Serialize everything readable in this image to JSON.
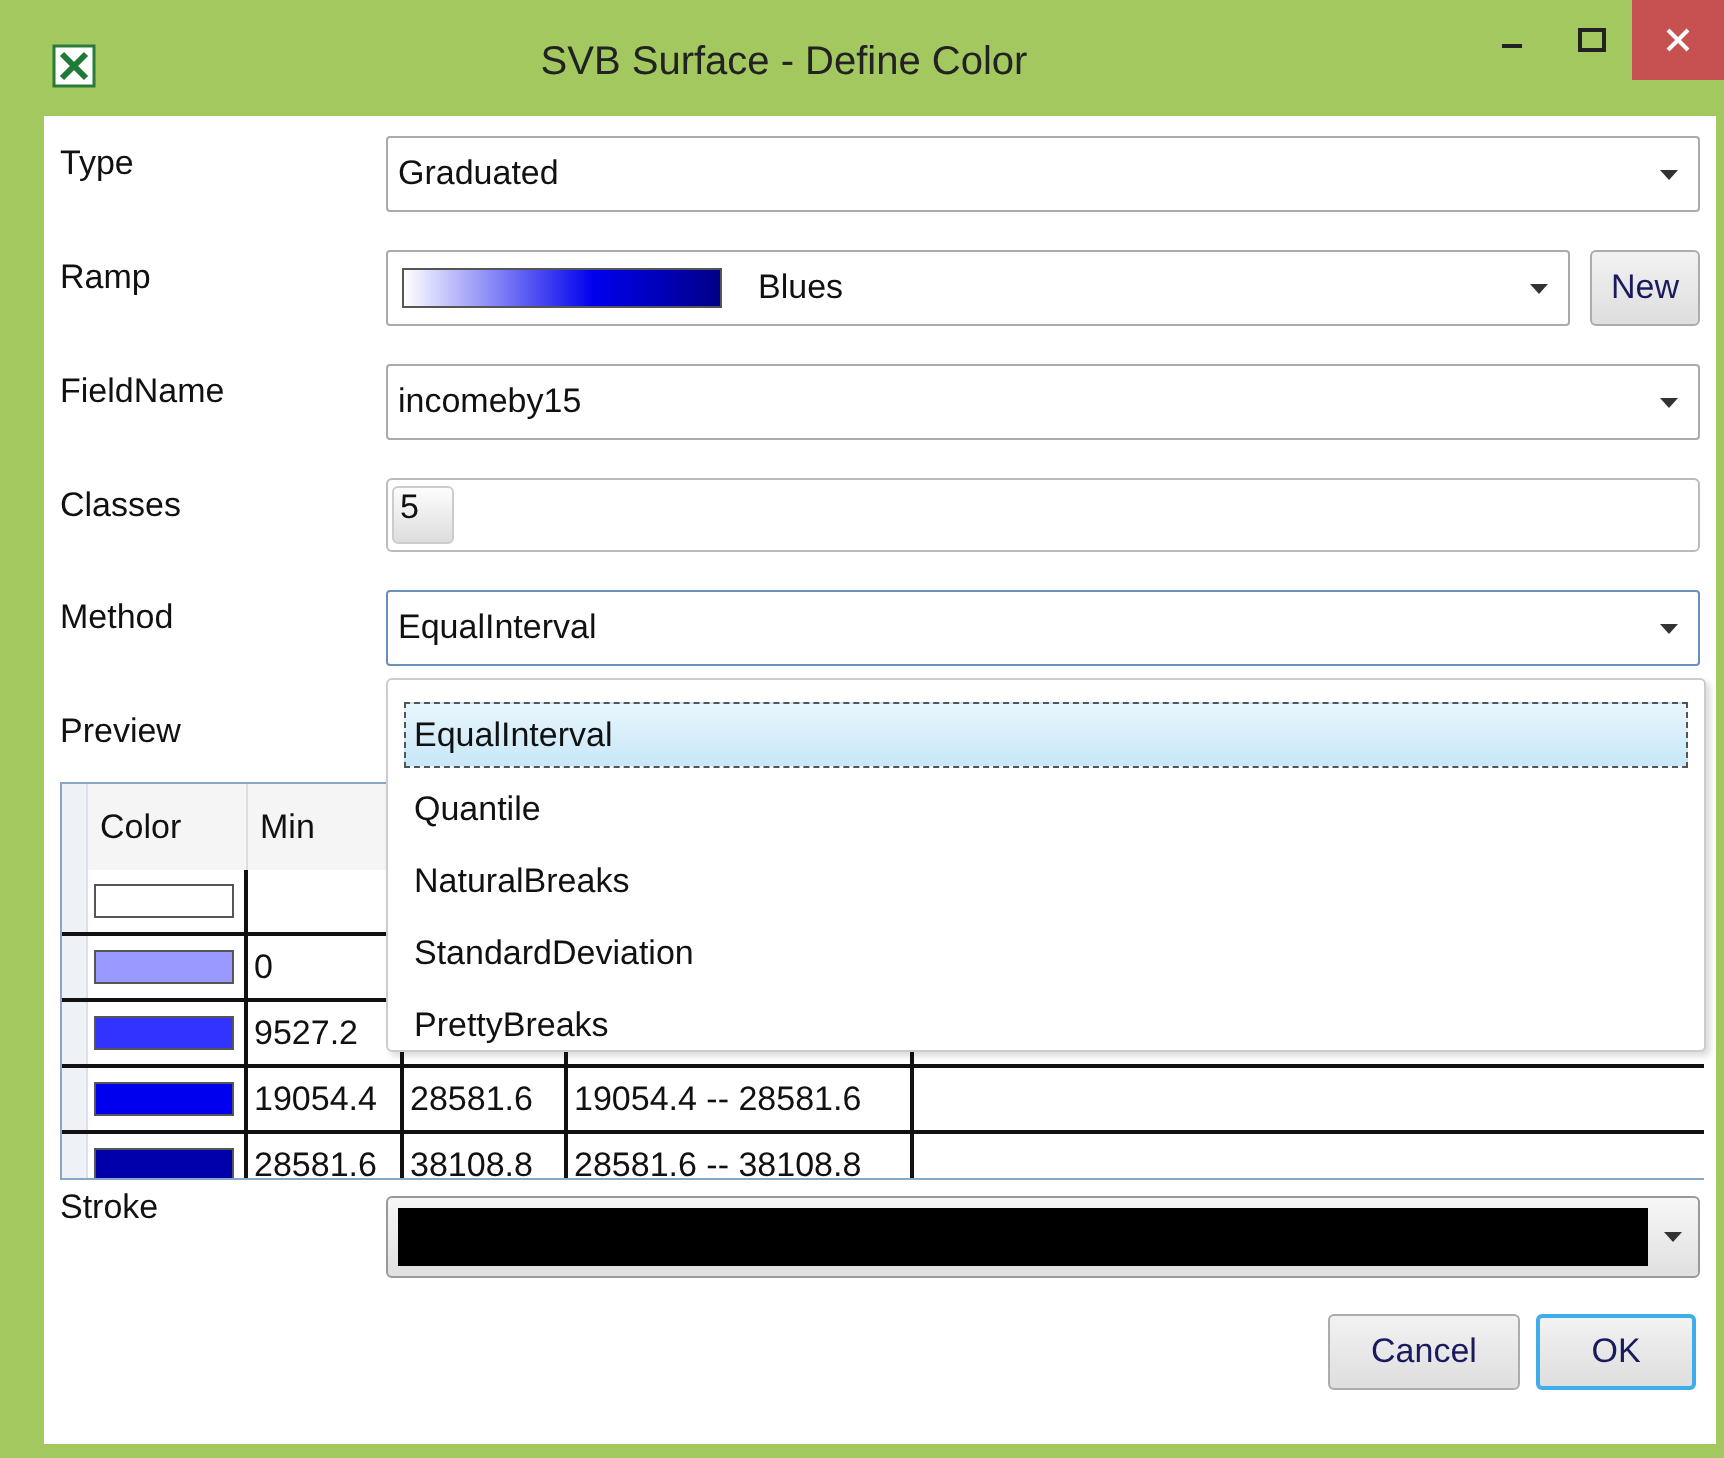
{
  "window": {
    "title": "SVB Surface - Define Color"
  },
  "form": {
    "type": {
      "label": "Type",
      "value": "Graduated"
    },
    "ramp": {
      "label": "Ramp",
      "value": "Blues",
      "button": "New"
    },
    "field_name": {
      "label": "FieldName",
      "value": "incomeby15"
    },
    "classes": {
      "label": "Classes",
      "value": "5"
    },
    "method": {
      "label": "Method",
      "value": "EqualInterval",
      "expanded": true,
      "options": [
        {
          "label": "EqualInterval",
          "selected": true
        },
        {
          "label": "Quantile",
          "selected": false
        },
        {
          "label": "NaturalBreaks",
          "selected": false
        },
        {
          "label": "StandardDeviation",
          "selected": false
        },
        {
          "label": "PrettyBreaks",
          "selected": false
        }
      ]
    },
    "preview": {
      "label": "Preview"
    },
    "table": {
      "columns": [
        "Color",
        "Min"
      ],
      "rows": [
        {
          "color": "#ffffff"
        },
        {
          "color": "#9999ff",
          "cells": [
            "0"
          ]
        },
        {
          "color": "#3333ff",
          "cells": [
            "9527.2"
          ]
        },
        {
          "color": "#0000ee",
          "cells": [
            "19054.4",
            "28581.6",
            "19054.4 -- 28581.6"
          ]
        },
        {
          "color": "#0000aa",
          "cells": [
            "28581.6",
            "38108.8",
            "28581.6 -- 38108.8"
          ]
        }
      ]
    },
    "stroke": {
      "label": "Stroke",
      "color": "#000000"
    }
  },
  "buttons": [
    "Cancel",
    "OK"
  ]
}
